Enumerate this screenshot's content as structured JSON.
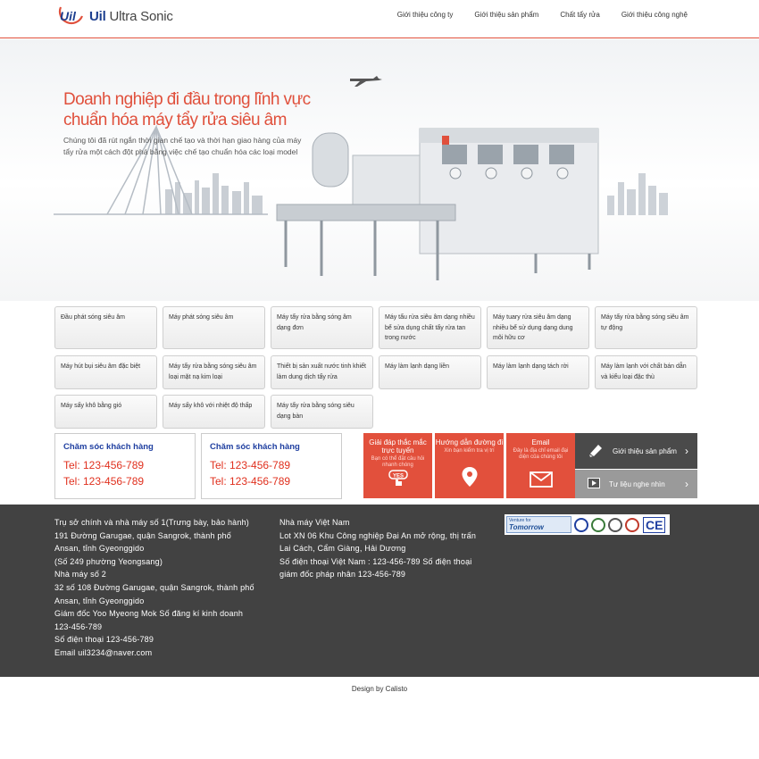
{
  "header": {
    "logo_mark": "Uil",
    "logo_brand": "Uil",
    "logo_rest": "Ultra Sonic",
    "nav": [
      "Giới thiệu công ty",
      "Giới thiệu sản phẩm",
      "Chất tẩy rửa",
      "Giới thiệu công nghệ"
    ]
  },
  "hero": {
    "title_line1": "Doanh nghiệp đi đầu trong lĩnh vực",
    "title_line2": "chuẩn hóa máy tẩy rửa siêu âm",
    "description": "Chúng tôi đã rút ngắn thời gian chế tạo và thời hạn giao hàng của máy tẩy rửa một cách đột phá bằng việc chế tạo chuẩn hóa các loại model"
  },
  "categories": [
    "Đầu phát sóng siêu âm",
    "Máy phát sóng siêu âm",
    "Máy tẩy rửa bằng sóng âm dạng đơn",
    "Máy tẩu rửa siêu âm dạng nhiều bể sửa dụng chất tẩy rửa tan trong nước",
    "Máy tuary rửa siêu âm dạng nhiều bể sử dụng dạng dung môi hữu cơ",
    "Máy tẩy rửa bằng sóng siêu âm tự động",
    "Máy hút bụi siêu âm đặc biệt",
    "Máy tẩy rửa bằng sóng siêu âm loại mặt nạ kim loại",
    "Thiết bị sản xuất nước tinh khiết làm dung dịch tẩy rửa",
    "Máy làm lạnh dạng liền",
    "Máy làm lạnh dạng tách rời",
    "Máy làm lạnh với chất bán dẫn và kiểu loại đặc thù",
    "Máy sấy khô bằng gió",
    "Máy sấy khô với nhiệt độ thấp",
    "Máy tẩy rửa bằng sóng siêu dạng bàn"
  ],
  "contacts": [
    {
      "title": "Chăm sóc khách hàng",
      "tel1": "Tel: 123-456-789",
      "tel2": "Tel: 123-456-789"
    },
    {
      "title": "Chăm sóc khách hàng",
      "tel1": "Tel: 123-456-789",
      "tel2": "Tel: 123-456-789"
    }
  ],
  "actions": [
    {
      "title": "Giải đáp thắc mắc trực tuyến",
      "sub": "Bạn có thể đặt câu hỏi nhanh chóng",
      "icon": "yes-hand-icon"
    },
    {
      "title": "Hướng dẫn đường đi",
      "sub": "Xin bạn kiểm tra vị trí",
      "icon": "map-pin-icon"
    },
    {
      "title": "Email",
      "sub": "Đây là địa chỉ email đại diện của chúng tôi",
      "icon": "envelope-icon"
    }
  ],
  "side_buttons": {
    "product_intro": "Giới thiệu sản phẩm",
    "media": "Tư liệu nghe nhìn"
  },
  "footer": {
    "col1": [
      "Trụ sở chính và nhà máy số 1(Trưng bày, bảo hành)",
      "191 Đường Garugae, quận Sangrok, thành phố",
      "Ansan, tỉnh Gyeonggido",
      "(Số 249 phường Yeongsang)",
      "Nhà máy số 2",
      "32 số 108 Đường Garugae, quận Sangrok, thành phố",
      "Ansan, tỉnh Gyeonggido",
      "Giám đốc Yoo Myeong Mok Số đăng kí kinh doanh",
      "123-456-789",
      "Số điện thoại 123-456-789",
      "Email uil3234@naver.com"
    ],
    "col2": [
      "Nhà máy Việt Nam",
      "Lot XN 06 Khu Công nghiệp Đại An mở rộng, thị trấn",
      "Lai Cách, Cẩm Giàng, Hải Dương",
      "Số điện thoại Việt Nam : 123-456-789 Số điện thoại",
      "giám đốc pháp nhân 123-456-789"
    ],
    "badge_venture_top": "Venture for",
    "badge_venture_bottom": "Tomorrow",
    "badge_ce": "CE"
  },
  "credit": "Design by  Calisto"
}
